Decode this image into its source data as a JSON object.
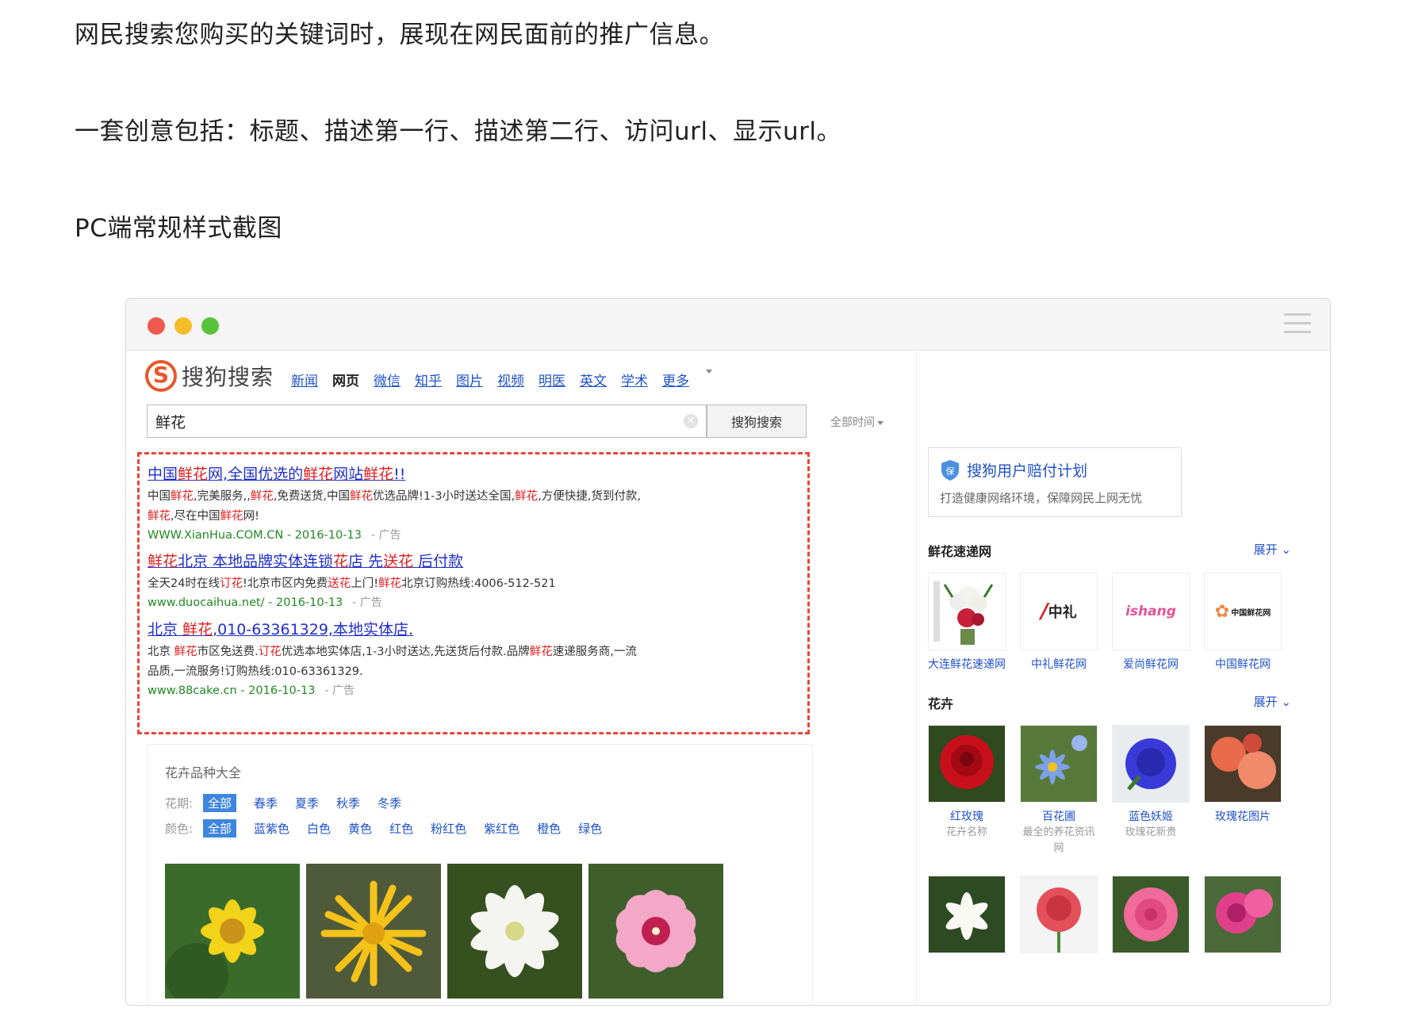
{
  "paragraphs": [
    "网民搜索您购买的关键词时，展现在网民面前的推广信息。",
    "一套创意包括：标题、描述第一行、描述第二行、访问url、显示url。",
    "PC端常规样式截图"
  ],
  "browser": {
    "logo_letter": "S",
    "logo_text": "搜狗搜索",
    "nav": [
      "新闻",
      "网页",
      "微信",
      "知乎",
      "图片",
      "视频",
      "明医",
      "英文",
      "学术",
      "更多"
    ],
    "active_nav": "网页",
    "search_value": "鲜花",
    "search_button": "搜狗搜索",
    "time_filter": "全部时间",
    "clear_glyph": "×"
  },
  "ads": [
    {
      "title_parts": [
        "中国",
        "鲜花",
        "网,全国优选的",
        "鲜花",
        "网站",
        "鲜花",
        "!!"
      ],
      "desc1_parts": [
        "中国",
        "鲜花",
        ",完美服务,,",
        "鲜花",
        ",免费送货,中国",
        "鲜花",
        "优选品牌!1-3小时送达全国,",
        "鲜花",
        ",方便快捷,货到付款,"
      ],
      "desc2_parts": [
        "",
        "鲜花",
        ",尽在中国",
        "鲜花",
        "网!"
      ],
      "url": "WWW.XianHua.COM.CN - 2016-10-13",
      "tag": "- 广告"
    },
    {
      "title_parts": [
        "",
        "鲜花",
        "北京 本地品牌实体连锁",
        "花",
        "店 先",
        "送花",
        " 后付款"
      ],
      "desc1_parts": [
        "全天24时在线",
        "订花",
        "!北京市区内免费",
        "送花",
        "上门!",
        "鲜花",
        "北京订购热线:4006-512-521"
      ],
      "desc2_parts": [],
      "url": "www.duocaihua.net/ - 2016-10-13",
      "tag": "- 广告"
    },
    {
      "title_parts": [
        "北京 ",
        "鲜花",
        ",010-63361329,本地实体店."
      ],
      "desc1_parts": [
        "北京 ",
        "鲜花",
        "市区免送费.",
        "订花",
        "优选本地实体店,1-3小时送达,先送货后付款.品牌",
        "鲜花",
        "速递服务商,一流"
      ],
      "desc2_parts": [
        "品质,一流服务!订购热线:010-63361329."
      ],
      "url": "www.88cake.cn - 2016-10-13",
      "tag": "- 广告"
    }
  ],
  "knowledge": {
    "title": "花卉品种大全",
    "season_label": "花期:",
    "seasons": [
      "全部",
      "春季",
      "夏季",
      "秋季",
      "冬季"
    ],
    "color_label": "颜色:",
    "colors": [
      "全部",
      "蓝紫色",
      "白色",
      "黄色",
      "红色",
      "粉红色",
      "紫红色",
      "橙色",
      "绿色"
    ]
  },
  "sidebar": {
    "promo_title": "搜狗用户赔付计划",
    "promo_sub": "打造健康网络环境，保障网民上网无忧",
    "promo_icon_glyph": "保",
    "section1": "鲜花速递网",
    "expand": "展开",
    "sites": [
      {
        "name": "大连鲜花速递网",
        "logo": "bouquet"
      },
      {
        "name": "中礼鲜花网",
        "logo": "中礼"
      },
      {
        "name": "爱尚鲜花网",
        "logo": "ishang"
      },
      {
        "name": "中国鲜花网",
        "logo": "中国鲜花网"
      }
    ],
    "section2": "花卉",
    "flowers": [
      {
        "name": "红玫瑰",
        "sub": "花卉名称"
      },
      {
        "name": "百花圃",
        "sub": "最全的养花资讯网"
      },
      {
        "name": "蓝色妖姬",
        "sub": "玫瑰花新贵"
      },
      {
        "name": "玫瑰花图片",
        "sub": ""
      }
    ]
  }
}
